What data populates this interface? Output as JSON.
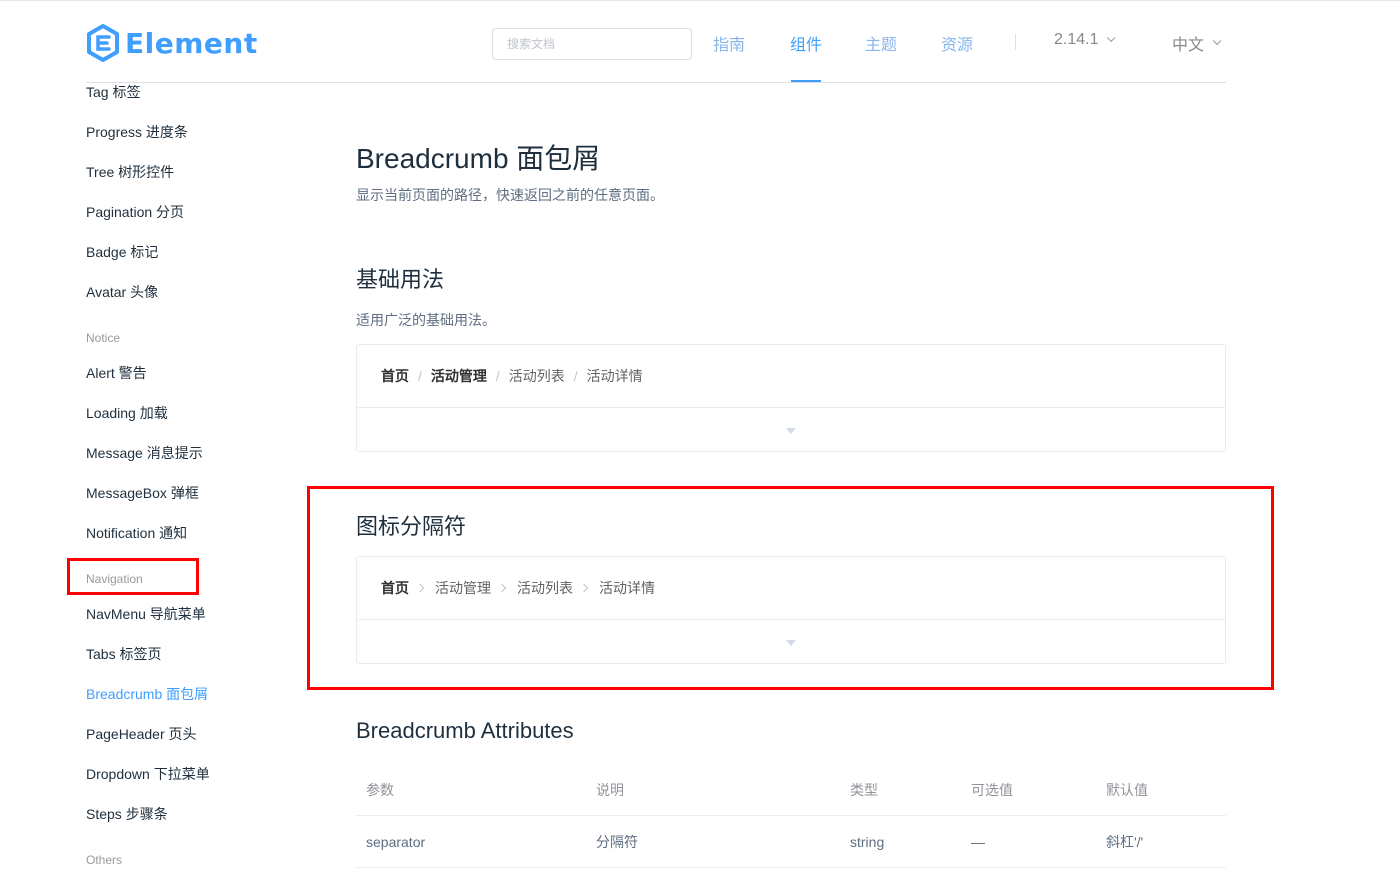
{
  "header": {
    "logo_text": "Element",
    "search_placeholder": "搜索文档",
    "nav": [
      "指南",
      "组件",
      "主题",
      "资源"
    ],
    "active_nav": "组件",
    "version": "2.14.1",
    "language": "中文",
    "colors": {
      "accent": "#409eff",
      "nav_inactive": "#88b5ec"
    }
  },
  "sidebar": {
    "items_top": [
      "Tag 标签",
      "Progress 进度条",
      "Tree 树形控件",
      "Pagination 分页",
      "Badge 标记",
      "Avatar 头像"
    ],
    "group_notice": "Notice",
    "items_notice": [
      "Alert 警告",
      "Loading 加载",
      "Message 消息提示",
      "MessageBox 弹框",
      "Notification 通知"
    ],
    "group_navigation": "Navigation",
    "items_navigation": [
      "NavMenu 导航菜单",
      "Tabs 标签页",
      "Breadcrumb 面包屑",
      "PageHeader 页头",
      "Dropdown 下拉菜单",
      "Steps 步骤条"
    ],
    "active_item": "Breadcrumb 面包屑",
    "group_others": "Others"
  },
  "main": {
    "title": "Breadcrumb 面包屑",
    "description": "显示当前页面的路径，快速返回之前的任意页面。",
    "basic": {
      "title": "基础用法",
      "description": "适用广泛的基础用法。",
      "crumbs": [
        "首页",
        "活动管理",
        "活动列表",
        "活动详情"
      ],
      "separator": "/"
    },
    "icon_sep": {
      "title": "图标分隔符",
      "crumbs": [
        "首页",
        "活动管理",
        "活动列表",
        "活动详情"
      ]
    },
    "attributes": {
      "title": "Breadcrumb Attributes",
      "columns": [
        "参数",
        "说明",
        "类型",
        "可选值",
        "默认值"
      ],
      "rows": [
        [
          "separator",
          "分隔符",
          "string",
          "—",
          "斜杠'/'"
        ]
      ]
    }
  },
  "annotations": {
    "highlight_color": "#ff0000"
  }
}
